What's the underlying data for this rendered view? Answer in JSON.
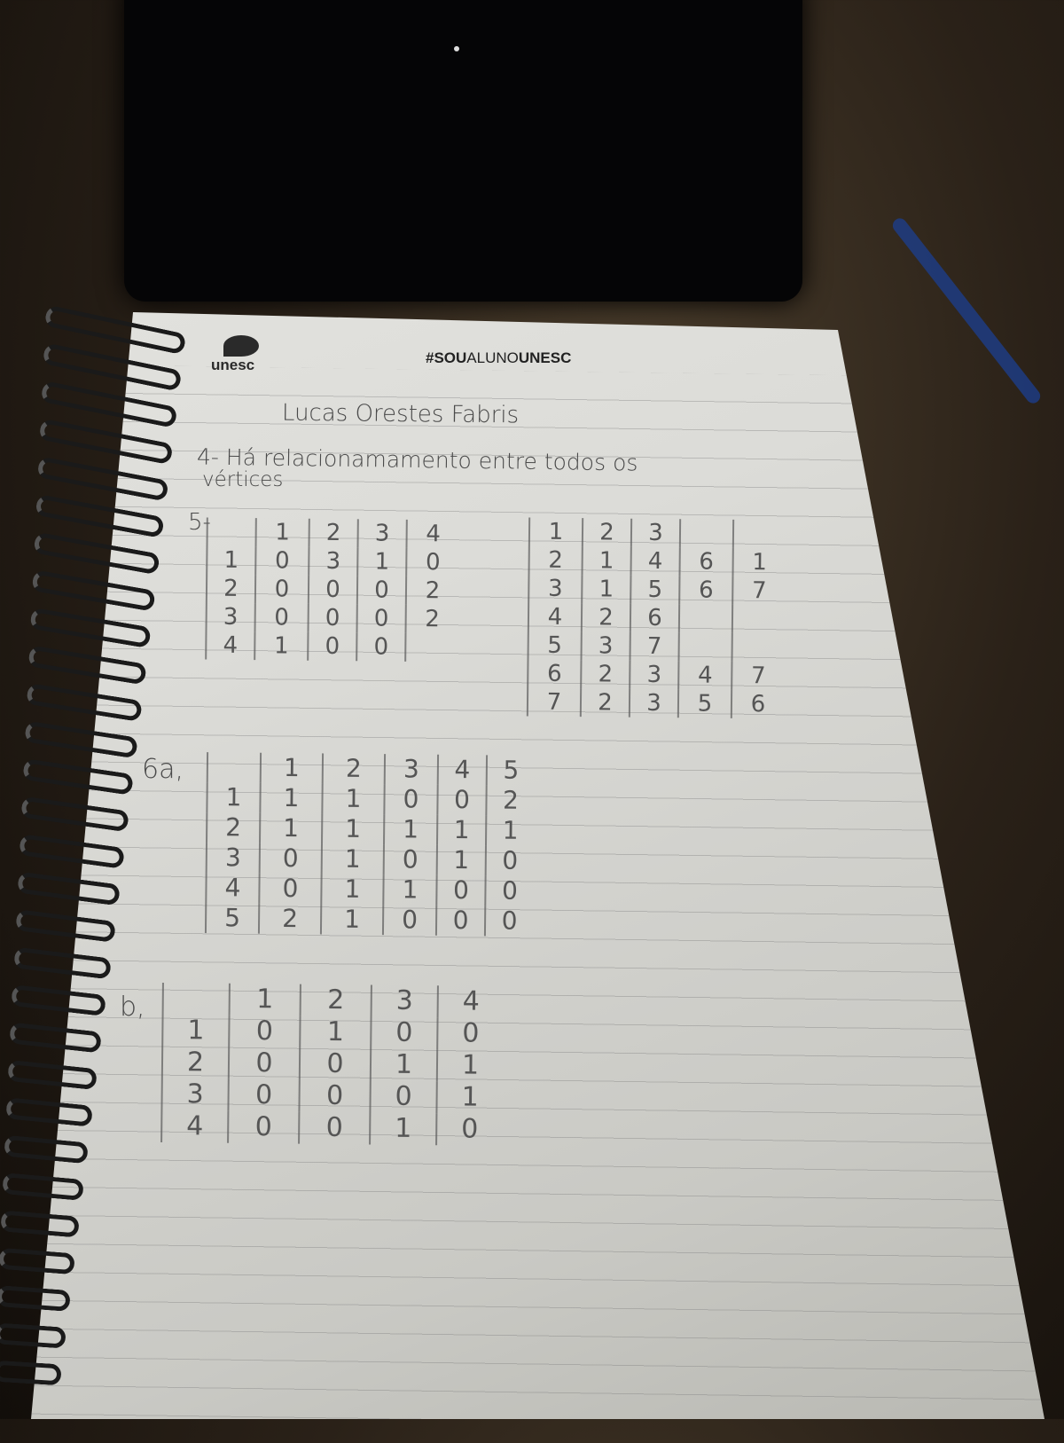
{
  "notebook": {
    "brand": "unesc",
    "hashtag_prefix": "#SOU",
    "hashtag_mid": "ALUNO",
    "hashtag_suffix": "UNESC"
  },
  "handwriting": {
    "name": "Lucas   Orestes   Fabris",
    "q4_line1": "4- Há  relacionamamento  entre  todos  os",
    "q4_line2": "vértices",
    "q5_label": "5-",
    "q6a_label": "6a,",
    "q6b_label": "b,"
  },
  "tables": {
    "q5_matrix": [
      [
        "",
        "1",
        "2",
        "3",
        "4"
      ],
      [
        "1",
        "0",
        "3",
        "1",
        "0"
      ],
      [
        "2",
        "0",
        "0",
        "0",
        "2"
      ],
      [
        "3",
        "0",
        "0",
        "0",
        "2"
      ],
      [
        "4",
        "1",
        "0",
        "0",
        ""
      ]
    ],
    "q5_list": [
      [
        "1",
        "2",
        "3",
        "",
        ""
      ],
      [
        "2",
        "1",
        "4",
        "6",
        "1"
      ],
      [
        "3",
        "1",
        "5",
        "6",
        "7"
      ],
      [
        "4",
        "2",
        "6",
        "",
        ""
      ],
      [
        "5",
        "3",
        "7",
        "",
        ""
      ],
      [
        "6",
        "2",
        "3",
        "4",
        "7"
      ],
      [
        "7",
        "2",
        "3",
        "5",
        "6"
      ]
    ],
    "q6a_matrix": [
      [
        "",
        "1",
        "2",
        "3",
        "4",
        "5"
      ],
      [
        "1",
        "1",
        "1",
        "0",
        "0",
        "2"
      ],
      [
        "2",
        "1",
        "1",
        "1",
        "1",
        "1"
      ],
      [
        "3",
        "0",
        "1",
        "0",
        "1",
        "0"
      ],
      [
        "4",
        "0",
        "1",
        "1",
        "0",
        "0"
      ],
      [
        "5",
        "2",
        "1",
        "0",
        "0",
        "0"
      ]
    ],
    "q6b_matrix": [
      [
        "",
        "1",
        "2",
        "3",
        "4"
      ],
      [
        "1",
        "0",
        "1",
        "0",
        "0"
      ],
      [
        "2",
        "0",
        "0",
        "1",
        "1"
      ],
      [
        "3",
        "0",
        "0",
        "0",
        "1"
      ],
      [
        "4",
        "0",
        "0",
        "1",
        "0"
      ]
    ]
  }
}
